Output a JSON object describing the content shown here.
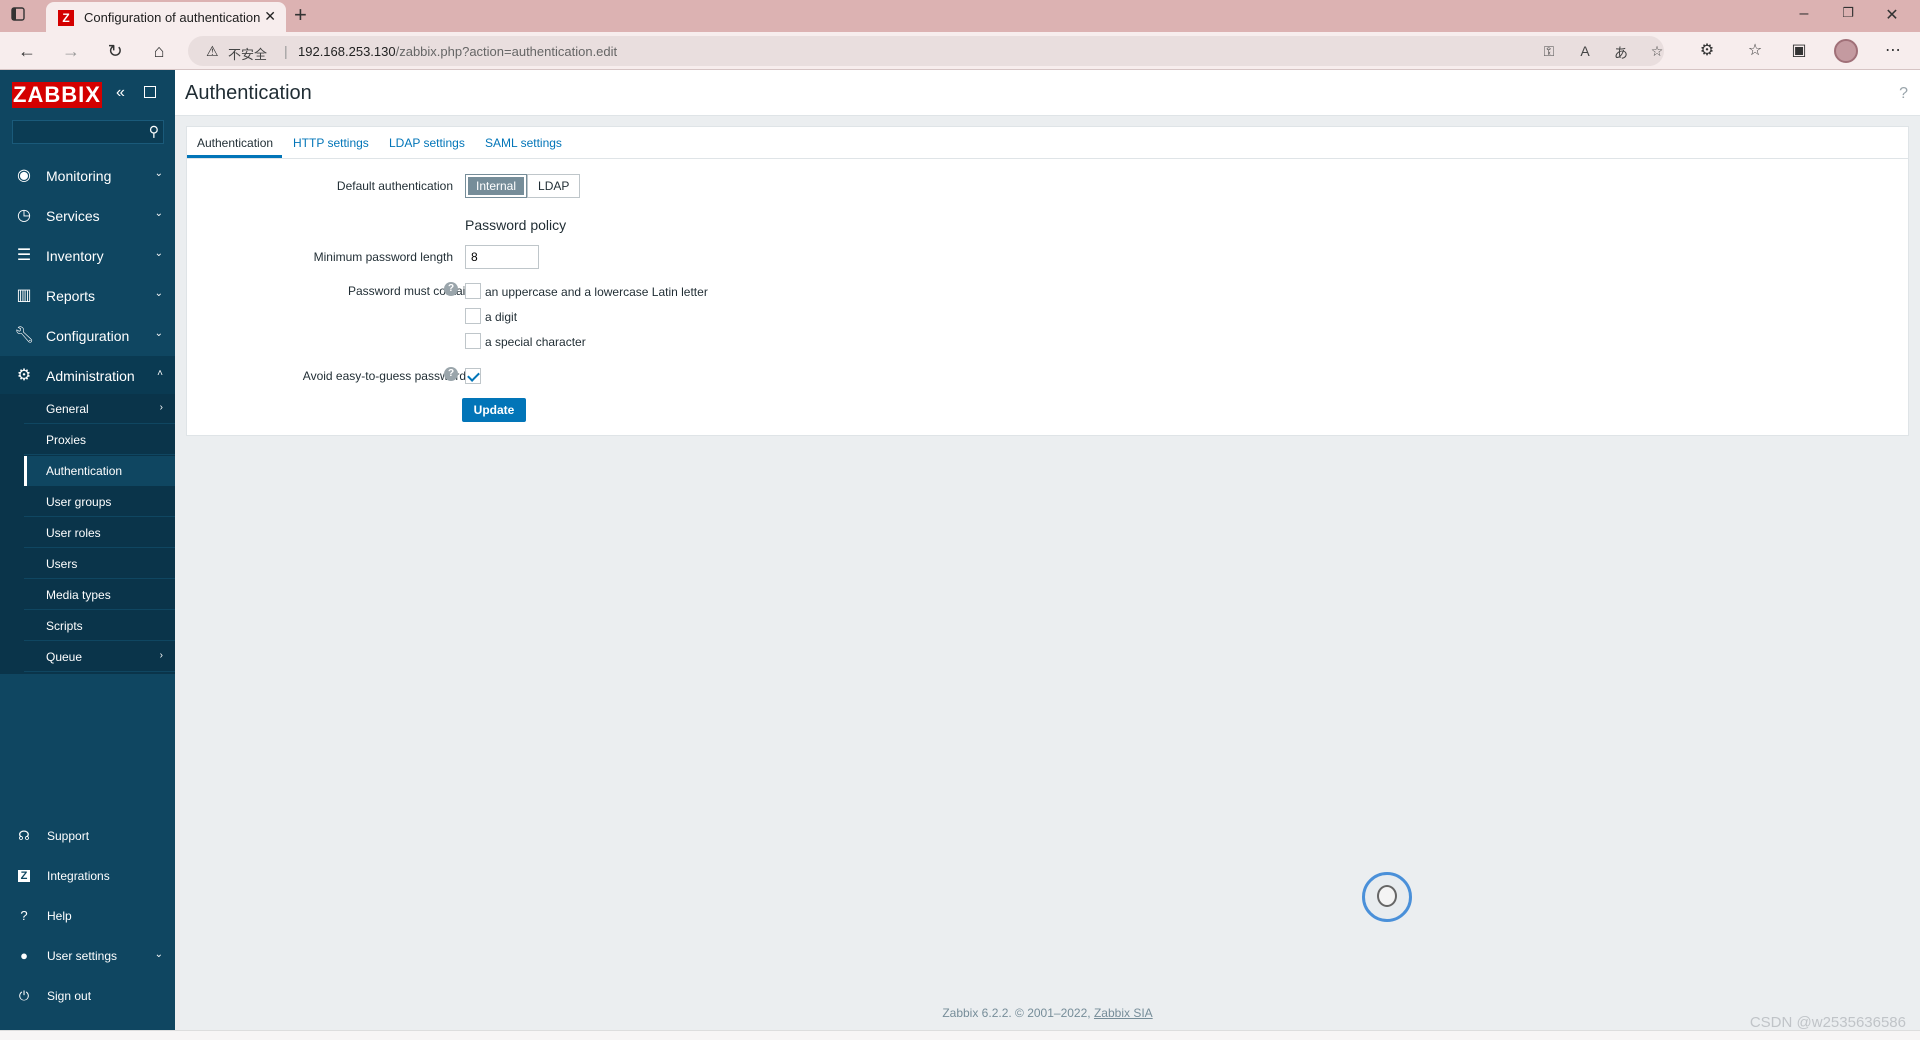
{
  "browser": {
    "tab_title": "Configuration of authentication",
    "favicon_letter": "Z",
    "insecure_label": "不安全",
    "url_host": "192.168.253.130",
    "url_path": "/zabbix.php?action=authentication.edit"
  },
  "sidebar": {
    "logo": "ZABBIX",
    "search_placeholder": "",
    "menu": [
      {
        "label": "Monitoring",
        "icon": "eye-icon"
      },
      {
        "label": "Services",
        "icon": "clock-icon"
      },
      {
        "label": "Inventory",
        "icon": "list-icon"
      },
      {
        "label": "Reports",
        "icon": "bar-chart-icon"
      },
      {
        "label": "Configuration",
        "icon": "wrench-icon"
      },
      {
        "label": "Administration",
        "icon": "gear-icon"
      }
    ],
    "admin_submenu": [
      {
        "label": "General",
        "has_children": true
      },
      {
        "label": "Proxies"
      },
      {
        "label": "Authentication",
        "selected": true
      },
      {
        "label": "User groups"
      },
      {
        "label": "User roles"
      },
      {
        "label": "Users"
      },
      {
        "label": "Media types"
      },
      {
        "label": "Scripts"
      },
      {
        "label": "Queue",
        "has_children": true
      }
    ],
    "bottom": [
      {
        "label": "Support",
        "icon": "headset-icon"
      },
      {
        "label": "Integrations",
        "icon": "integrations-icon"
      },
      {
        "label": "Help",
        "icon": "help-icon"
      },
      {
        "label": "User settings",
        "icon": "user-icon"
      },
      {
        "label": "Sign out",
        "icon": "power-icon"
      }
    ]
  },
  "page": {
    "title": "Authentication",
    "help_glyph": "?"
  },
  "tabs": [
    "Authentication",
    "HTTP settings",
    "LDAP settings",
    "SAML settings"
  ],
  "form": {
    "default_auth_label": "Default authentication",
    "default_auth_options": [
      "Internal",
      "LDAP"
    ],
    "default_auth_selected": "Internal",
    "policy_title": "Password policy",
    "min_length_label": "Minimum password length",
    "min_length_value": "8",
    "must_contain_label": "Password must contain",
    "must_contain_options": [
      {
        "label": "an uppercase and a lowercase Latin letter",
        "checked": false
      },
      {
        "label": "a digit",
        "checked": false
      },
      {
        "label": "a special character",
        "checked": false
      }
    ],
    "avoid_easy_label": "Avoid easy-to-guess passwords",
    "avoid_easy_checked": true,
    "update_label": "Update"
  },
  "footer": {
    "text": "Zabbix 6.2.2. © 2001–2022,",
    "link": "Zabbix SIA"
  },
  "watermark": "CSDN @w2535636586",
  "colors": {
    "sidebar": "#0f4661",
    "accent": "#0275b8",
    "logo": "#d40000"
  }
}
